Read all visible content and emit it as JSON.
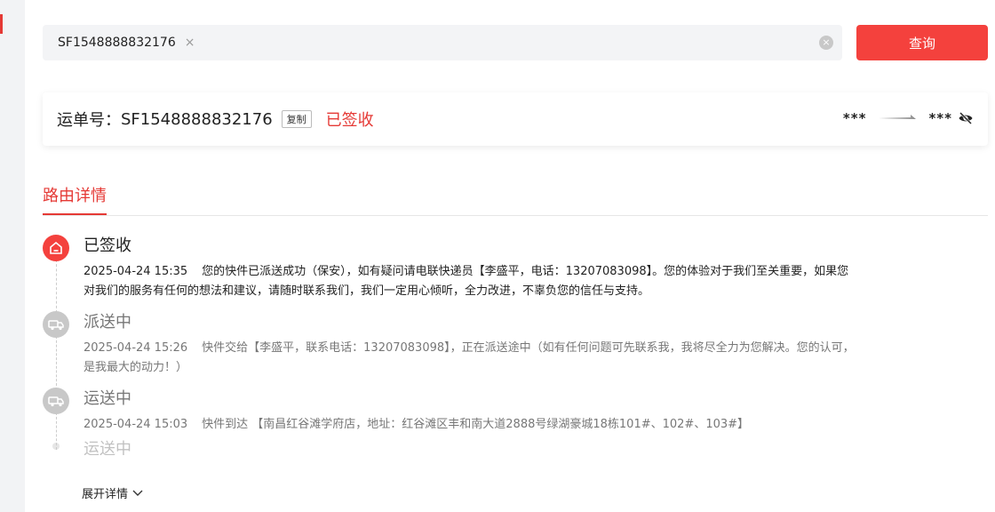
{
  "search": {
    "chip_value": "SF1548888832176",
    "chip_remove": "×",
    "clear_icon": "×",
    "button_label": "查询"
  },
  "waybill": {
    "label": "运单号：",
    "number": "SF1548888832176",
    "copy_label": "复制",
    "status": "已签收",
    "origin": "***",
    "destination": "***"
  },
  "tabs": {
    "active": "路由详情"
  },
  "timeline": [
    {
      "title": "已签收",
      "time": "2025-04-24 15:35",
      "text": "您的快件已派送成功（保安），如有疑问请电联快递员【李盛平，电话：13207083098】。您的体验对于我们至关重要，如果您对我们的服务有任何的想法和建议，请随时联系我们，我们一定用心倾听，全力改进，不辜负您的信任与支持。",
      "state": "active"
    },
    {
      "title": "派送中",
      "time": "2025-04-24 15:26",
      "text": "快件交给【李盛平，联系电话：13207083098】，正在派送途中（如有任何问题可先联系我，我将尽全力为您解决。您的认可，是我最大的动力！）",
      "state": "gray"
    },
    {
      "title": "运送中",
      "time": "2025-04-24 15:03",
      "text": "快件到达 【南昌红谷滩学府店，地址：红谷滩区丰和南大道2888号绿湖豪城18栋101#、102#、103#】",
      "state": "gray"
    },
    {
      "title": "运送中",
      "state": "faded"
    }
  ],
  "expand_label": "展开详情",
  "colors": {
    "accent": "#f4413d",
    "status_red": "#e53935",
    "inactive": "#c8c8c8"
  }
}
